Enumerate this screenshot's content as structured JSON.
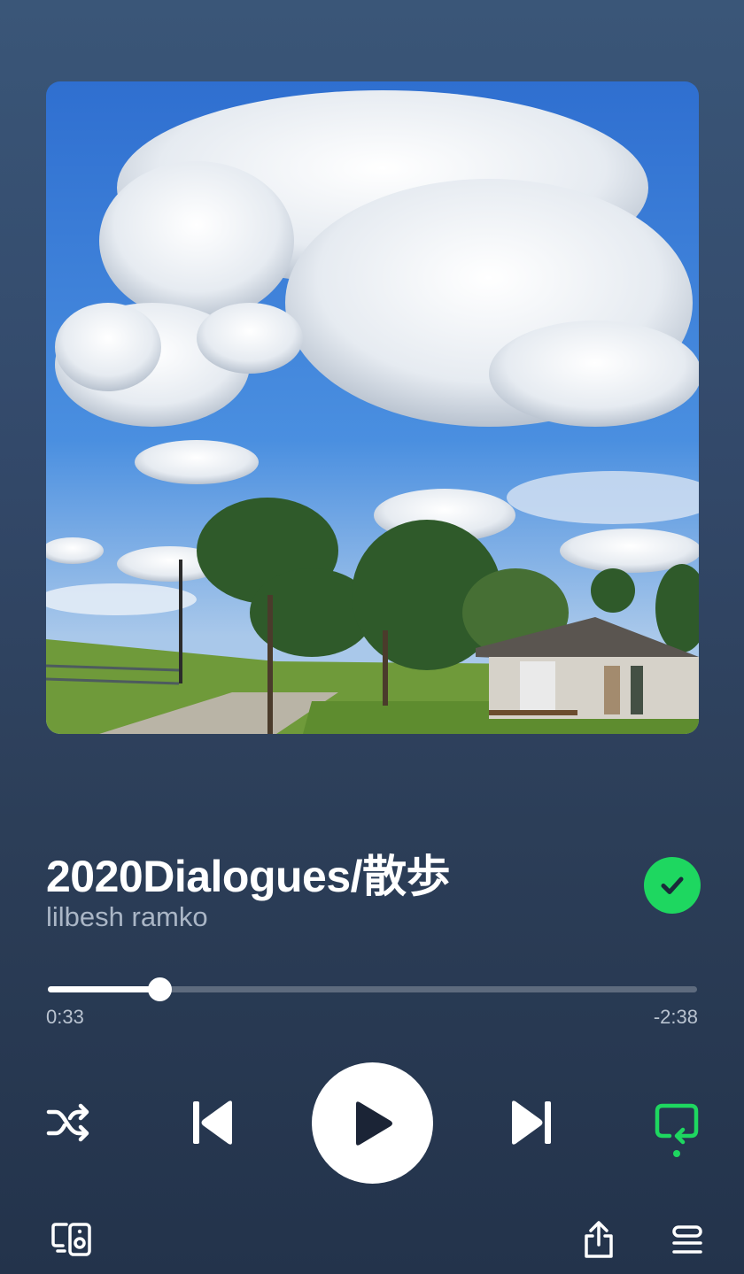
{
  "track": {
    "title": "2020Dialogues/散歩",
    "artist": "lilbesh ramko",
    "saved": true
  },
  "playback": {
    "elapsed": "0:33",
    "remaining": "-2:38",
    "progress_fraction": 0.172,
    "is_playing": false,
    "shuffle": false,
    "repeat": true
  },
  "icons": {
    "saved": "check-circle-icon",
    "shuffle": "shuffle-icon",
    "previous": "skip-previous-icon",
    "play": "play-icon",
    "next": "skip-next-icon",
    "repeat": "repeat-icon",
    "devices": "connect-devices-icon",
    "share": "share-icon",
    "queue": "queue-icon"
  },
  "colors": {
    "accent": "#1ed760",
    "background_top": "#3a5678",
    "background_bottom": "#23334b",
    "secondary_text": "#aab6c6"
  }
}
